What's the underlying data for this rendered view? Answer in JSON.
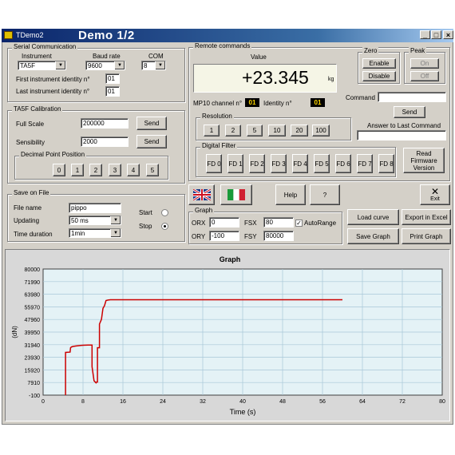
{
  "window": {
    "app_title": "TDemo2",
    "big_title": "Demo 1/2",
    "min_label": "_",
    "max_label": "□",
    "close_label": "×"
  },
  "serial": {
    "title": "Serial Communication",
    "instrument_label": "Instrument",
    "instrument_value": "TA5F",
    "baud_label": "Baud rate",
    "baud_value": "9600",
    "com_label": "COM",
    "com_value": "8",
    "first_id_label": "First instrument identity n°",
    "first_id_value": "01",
    "last_id_label": "Last instrument identity n°",
    "last_id_value": "01"
  },
  "calibration": {
    "title": "TA5F Calibration",
    "full_scale_label": "Full Scale",
    "full_scale_value": "200000",
    "sensibility_label": "Sensibility",
    "sensibility_value": "2000",
    "send_label": "Send",
    "dp_title": "Decimal Point Position",
    "dp_buttons": [
      "0",
      "1",
      "2",
      "3",
      "4",
      "5"
    ]
  },
  "save": {
    "title": "Save on File",
    "file_name_label": "File name",
    "file_name_value": "pippo",
    "updating_label": "Updating",
    "updating_value": "50 ms",
    "time_label": "Time duration",
    "time_value": "1min",
    "start_label": "Start",
    "stop_label": "Stop"
  },
  "remote": {
    "title": "Remote commands",
    "value_label": "Value",
    "value": "+23.345",
    "unit": "kg",
    "mp10_label": "MP10 channel n°",
    "mp10_value": "01",
    "identity_label": "Identity n°",
    "identity_value": "01",
    "zero_title": "Zero",
    "enable_label": "Enable",
    "disable_label": "Disable",
    "peak_title": "Peak",
    "on_label": "On",
    "off_label": "Off",
    "command_label": "Command",
    "send_label": "Send",
    "answer_label": "Answer to Last Command",
    "resolution_title": "Resolution",
    "resolution_buttons": [
      "1",
      "2",
      "5",
      "10",
      "20",
      "100"
    ],
    "filter_title": "Digital Filter",
    "filter_buttons": [
      "FD 0",
      "FD 1",
      "FD 2",
      "FD 3",
      "FD 4",
      "FD 5",
      "FD 6",
      "FD 7",
      "FD 8"
    ],
    "firmware_label": "Read Firmware Version"
  },
  "toolbar": {
    "help_label": "Help",
    "question_label": "?",
    "exit_label": "Exit"
  },
  "graph_settings": {
    "title": "Graph",
    "orx_label": "ORX",
    "orx_value": "0",
    "ory_label": "ORY",
    "ory_value": "-100",
    "fsx_label": "FSX",
    "fsx_value": "80",
    "fsy_label": "FSY",
    "fsy_value": "80000",
    "autorange_label": "AutoRange",
    "load_label": "Load curve",
    "export_label": "Export in Excel",
    "save_label": "Save Graph",
    "print_label": "Print Graph"
  },
  "chart_data": {
    "type": "line",
    "title": "Graph",
    "xlabel": "Time (s)",
    "ylabel": "(dN)",
    "xlim": [
      0,
      80
    ],
    "ylim": [
      -100,
      80000
    ],
    "xticks": [
      "0",
      "8",
      "16",
      "24",
      "32",
      "40",
      "48",
      "56",
      "64",
      "72",
      "80"
    ],
    "yticks": [
      "-100",
      "7910",
      "15920",
      "23930",
      "31940",
      "39950",
      "47960",
      "55970",
      "63980",
      "71990",
      "80000"
    ],
    "grid": true,
    "colors": {
      "line": "#cc0000",
      "plot_bg": "#e4f2f6",
      "grid": "#a8c8d8"
    },
    "series": [
      {
        "x": [
          4.5,
          4.5,
          5.4,
          5.5,
          5.7,
          6,
          6.5,
          7,
          7.5,
          8,
          9,
          9.8,
          9.8,
          10.2,
          10.6,
          10.7,
          10.9,
          10.9,
          11.3,
          11.3,
          11.7,
          12.0,
          12.3,
          12.6,
          13,
          13.5,
          14,
          15,
          16,
          20,
          30,
          40,
          50,
          60
        ],
        "y": [
          -100,
          27000,
          27200,
          30000,
          30500,
          30800,
          31100,
          31300,
          31500,
          31600,
          31700,
          31700,
          18000,
          9000,
          7700,
          8200,
          8200,
          30000,
          30000,
          45000,
          48000,
          55000,
          56700,
          60000,
          60300,
          60500,
          60500,
          60500,
          60500,
          60500,
          60500,
          60500,
          60500,
          60500
        ]
      }
    ]
  }
}
